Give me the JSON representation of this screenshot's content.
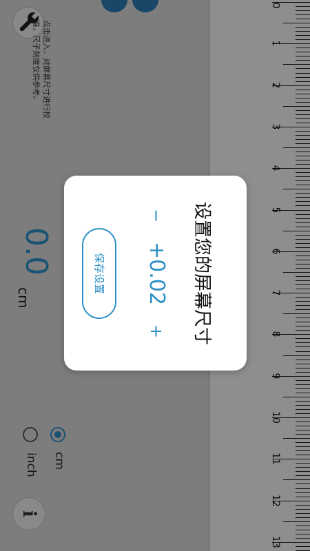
{
  "hint": {
    "text": "点击进入，对屏幕尺寸进行校准，尺子刻度仅供参考。"
  },
  "measurement": {
    "value": "0.0",
    "unit": "cm"
  },
  "units": {
    "options": [
      {
        "id": "cm",
        "label": "cm",
        "selected": true
      },
      {
        "id": "inch",
        "label": "inch",
        "selected": false
      }
    ]
  },
  "info": {
    "label": "i"
  },
  "ruler": {
    "labels": [
      "0",
      "1",
      "2",
      "3",
      "4",
      "5",
      "6",
      "7",
      "8",
      "9",
      "10",
      "11",
      "12",
      "13"
    ]
  },
  "dialog": {
    "title": "设置您的屏幕尺寸",
    "minus_label": "−",
    "plus_label": "+",
    "offset_value": "+0.02",
    "save_label": "保存设置"
  },
  "colors": {
    "accent": "#2d8fc6",
    "knob": "#2b7bb3"
  }
}
